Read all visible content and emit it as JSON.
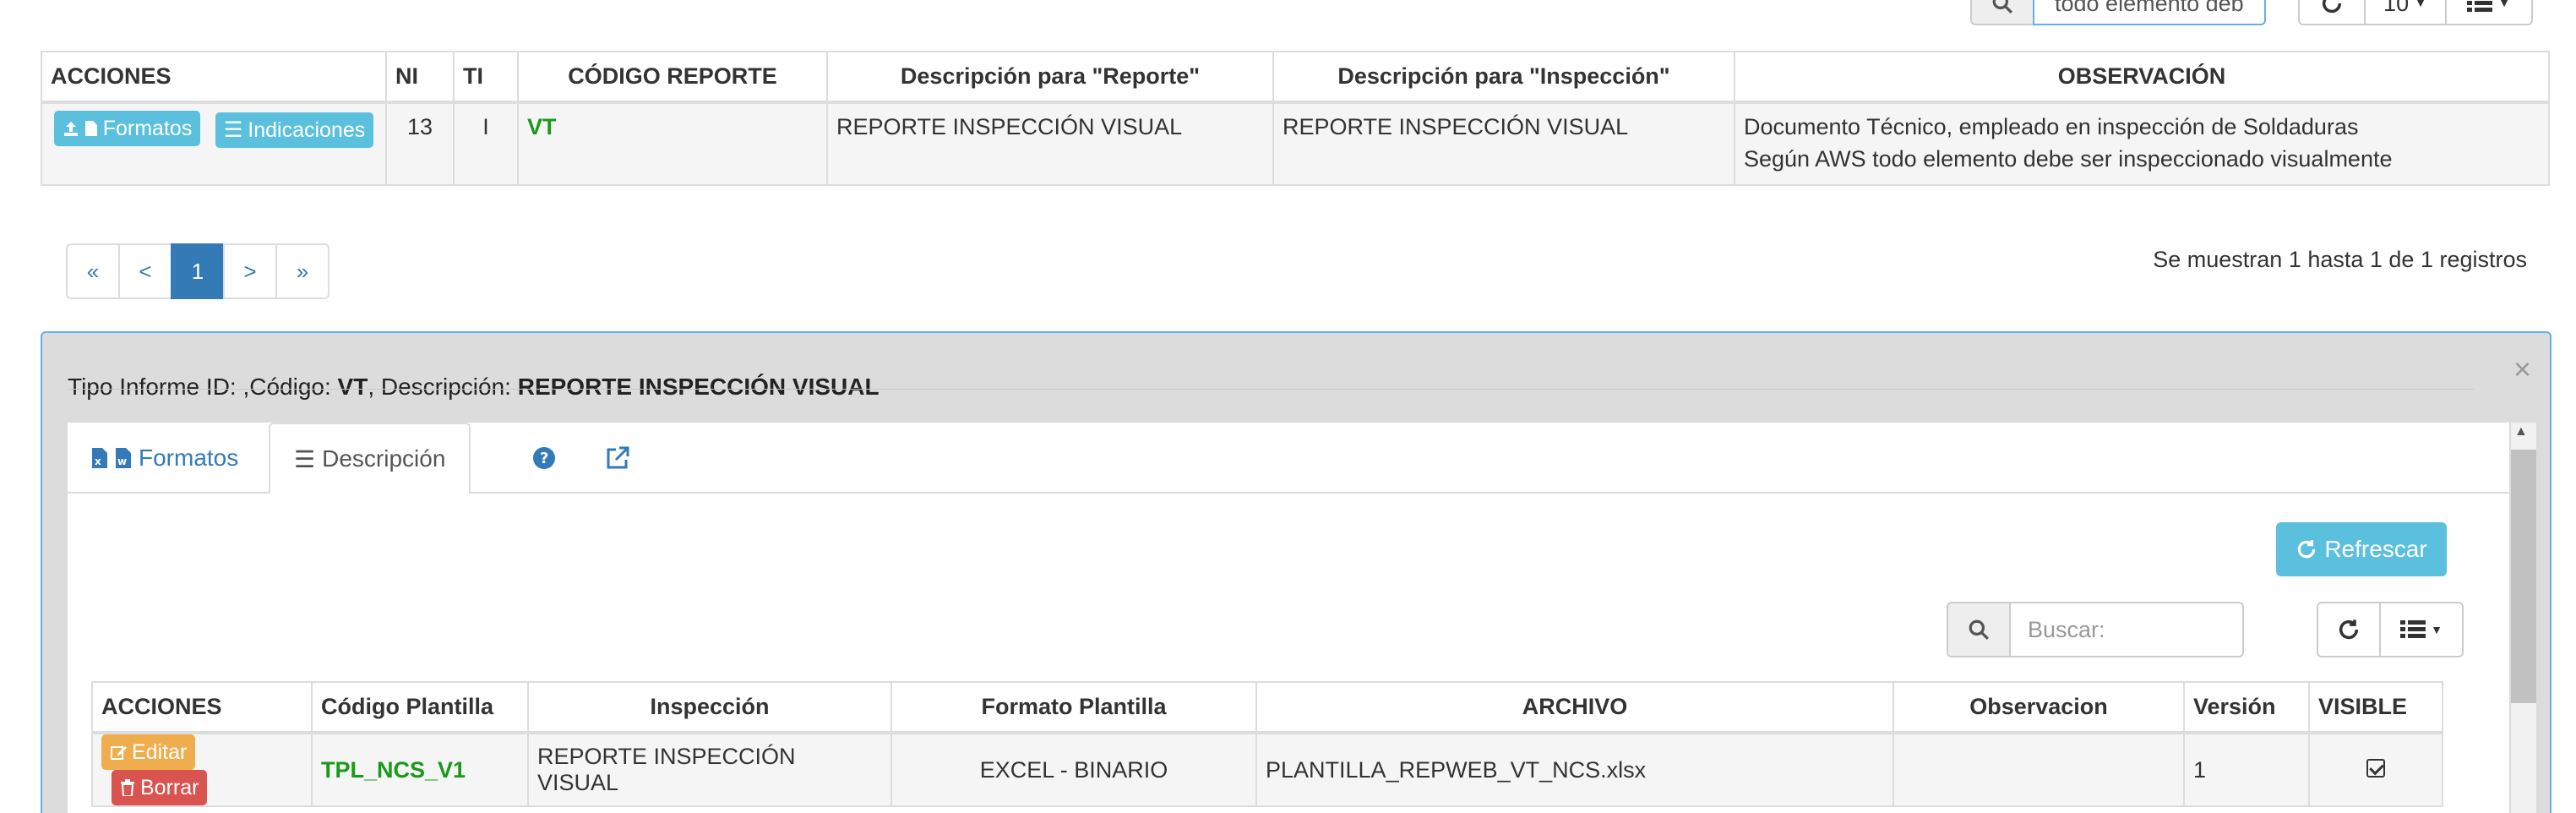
{
  "toolbar": {
    "search_value": "todo elemento deb",
    "page_size": "10"
  },
  "table": {
    "headers": [
      "ACCIONES",
      "NI",
      "TI",
      "CÓDIGO REPORTE",
      "Descripción para \"Reporte\"",
      "Descripción para \"Inspección\"",
      "OBSERVACIÓN"
    ],
    "row": {
      "btn_formatos": "Formatos",
      "btn_indicaciones": "Indicaciones",
      "ni": "13",
      "ti": "I",
      "codigo": "VT",
      "desc_reporte": "REPORTE INSPECCIÓN VISUAL",
      "desc_inspeccion": "REPORTE INSPECCIÓN VISUAL",
      "observacion_1": "Documento Técnico, empleado en inspección de Soldaduras",
      "observacion_2": "Según AWS todo elemento debe ser inspeccionado visualmente"
    }
  },
  "pagination": {
    "first": "«",
    "prev": "<",
    "current": "1",
    "next": ">",
    "last": "»",
    "info": "Se muestran 1 hasta 1 de 1 registros"
  },
  "panel": {
    "title_prefix": "Tipo Informe ID: ,Código: ",
    "title_code": "VT",
    "title_mid": ", Descripción: ",
    "title_desc": "REPORTE INSPECCIÓN VISUAL",
    "close": "×",
    "tabs": {
      "formatos": "Formatos",
      "descripcion": "Descripción"
    },
    "refresh_label": "Refrescar",
    "search_placeholder": "Buscar:",
    "table": {
      "headers": [
        "ACCIONES",
        "Código Plantilla",
        "Inspección",
        "Formato Plantilla",
        "ARCHIVO",
        "Observacion",
        "Versión",
        "VISIBLE"
      ],
      "row": {
        "btn_editar": "Editar",
        "btn_borrar": "Borrar",
        "codigo": "TPL_NCS_V1",
        "inspeccion": "REPORTE INSPECCIÓN VISUAL",
        "formato": "EXCEL - BINARIO",
        "archivo": "PLANTILLA_REPWEB_VT_NCS.xlsx",
        "observacion": "",
        "version": "1"
      }
    }
  },
  "colors": {
    "primary": "#337ab7",
    "info": "#5bc0de",
    "warning": "#f0ad4e",
    "danger": "#d9534f",
    "code_green": "#1a9a1a"
  }
}
